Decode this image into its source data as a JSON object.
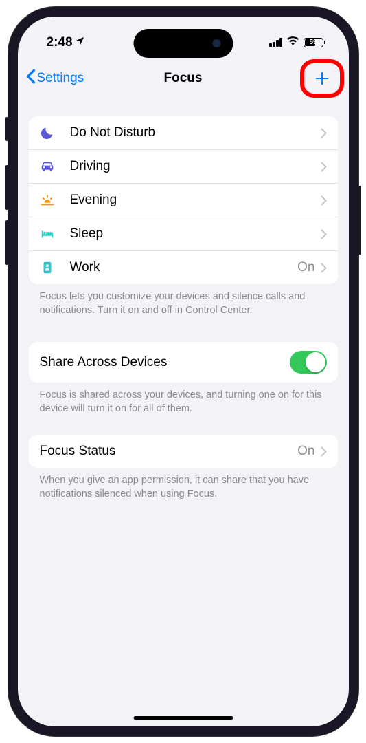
{
  "statusBar": {
    "time": "2:48",
    "battery": "59"
  },
  "nav": {
    "back": "Settings",
    "title": "Focus"
  },
  "focusList": [
    {
      "icon": "moon",
      "label": "Do Not Disturb",
      "color": "#5856d6",
      "detail": ""
    },
    {
      "icon": "car",
      "label": "Driving",
      "color": "#5856d6",
      "detail": ""
    },
    {
      "icon": "sunset",
      "label": "Evening",
      "color": "#ff9500",
      "detail": ""
    },
    {
      "icon": "bed",
      "label": "Sleep",
      "color": "#30d5c8",
      "detail": ""
    },
    {
      "icon": "badge",
      "label": "Work",
      "color": "#30c1cc",
      "detail": "On"
    }
  ],
  "footers": {
    "focusList": "Focus lets you customize your devices and silence calls and notifications. Turn it on and off in Control Center.",
    "share": "Focus is shared across your devices, and turning one on for this device will turn it on for all of them.",
    "status": "When you give an app permission, it can share that you have notifications silenced when using Focus."
  },
  "share": {
    "label": "Share Across Devices",
    "on": true
  },
  "status": {
    "label": "Focus Status",
    "value": "On"
  }
}
